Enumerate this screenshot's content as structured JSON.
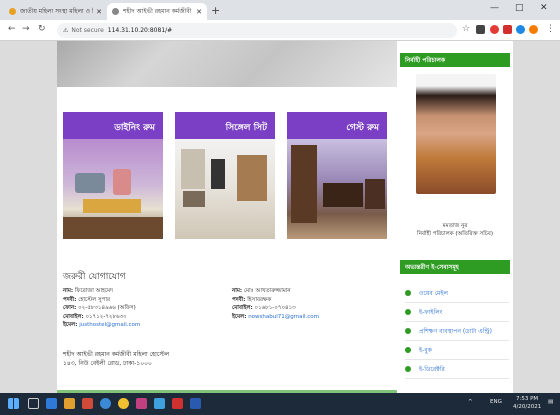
{
  "browser": {
    "tabs": [
      {
        "title": "জাতীয় মহিলা সংস্থা মহিলা ও শিশু",
        "active": false
      },
      {
        "title": "শহীদ আইভী রহমান কর্মজীবী মহি",
        "active": true
      }
    ],
    "new_tab": "+",
    "address": {
      "security": "Not secure",
      "url": "114.31.10.20:8081/#"
    },
    "window_controls": [
      "—",
      "□",
      "✕"
    ]
  },
  "main": {
    "cards": [
      {
        "title": "ডাইনিং রুম"
      },
      {
        "title": "সিঙ্গেল সিট"
      },
      {
        "title": "গেস্ট রুম"
      }
    ],
    "contact": {
      "title": "জরুরী যোগাযোগ",
      "left": [
        {
          "label": "নাম:",
          "value": "ফিরোজা আহমেদ"
        },
        {
          "label": "পদবী:",
          "value": "হোস্টেল সুপার"
        },
        {
          "label": "ফোন:",
          "value": "০২-৫৮৩১৪৯৬৬ (অফিস)"
        },
        {
          "label": "মোবাইল:",
          "value": "০১৭১২-৭২৮৬৩০"
        },
        {
          "label": "ইমেল:",
          "value": "justhostel@gmail.com"
        }
      ],
      "right": [
        {
          "label": "নাম:",
          "value": "মোঃ আখতারুজ্জামান"
        },
        {
          "label": "পদবী:",
          "value": "হিসাবরক্ষক"
        },
        {
          "label": "মোবাইল:",
          "value": "০১৬৮১-০৭০৪১৩"
        },
        {
          "label": "ইমেল:",
          "value": "nowshabul71@gmail.com"
        }
      ],
      "address_lines": [
        "শহীদ আইভী রহমান কর্মজীবী মহিলা হোস্টেল",
        "১৪৩, নিউ বেইলী রোড, ঢাকা-১০০০"
      ]
    }
  },
  "sidebar": {
    "officer_header": "নির্বাহী পরিচালক",
    "officer_name": "মমতাজ নুর",
    "officer_title": "নির্বাহী পরিচালক (অতিরিক্ত সচিব)",
    "services_header": "অভ্যন্তরীণ ই-সেবাসমূহ",
    "services": [
      "ওয়েব মেইল",
      "ই-ফাইলিং",
      "প্রশিক্ষণ ব্যবস্থাপন (ডাটা এন্ট্রি)",
      "ই-বুক",
      "ই-ডিরেক্টরি"
    ]
  },
  "taskbar": {
    "tray_lang": "ENG",
    "time": "7:53 PM",
    "date": "4/20/2021"
  }
}
